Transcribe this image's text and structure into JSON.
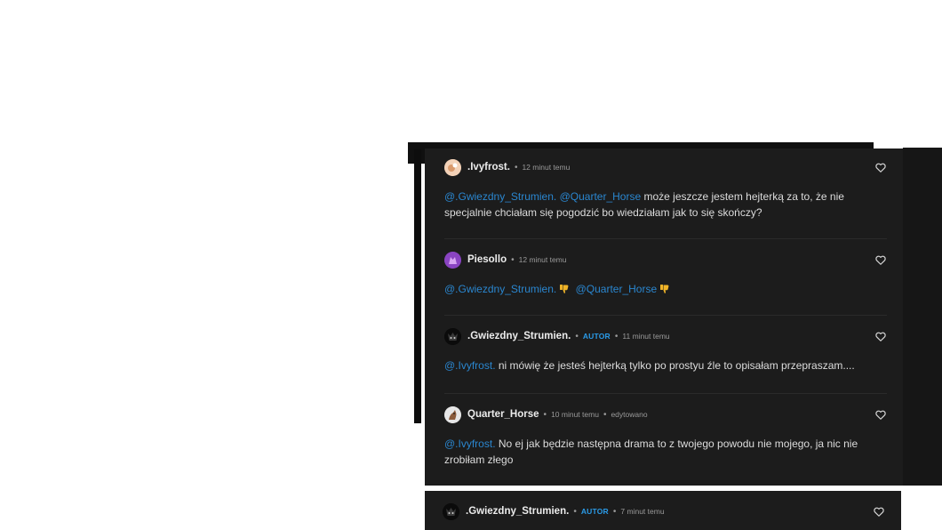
{
  "comments": [
    {
      "username": ".Ivyfrost.",
      "time": "12 minut temu",
      "mentions": [
        "@.Gwiezdny_Strumien.",
        "@Quarter_Horse"
      ],
      "text": "może jeszcze jestem hejterką za to, że nie specjalnie chciałam się pogodzić bo wiedziałam jak to się skończy?"
    },
    {
      "username": "Piesollo",
      "time": "12 minut temu",
      "mentions": [
        "@.Gwiezdny_Strumien.",
        "@Quarter_Horse"
      ],
      "reaction_icon": "thumbs-down-emoji"
    },
    {
      "username": ".Gwiezdny_Strumien.",
      "badge": "AUTOR",
      "time": "11 minut temu",
      "mentions": [
        "@.Ivyfrost."
      ],
      "text": "ni mówię że jesteś hejterką tylko po prostyu źle to opisałam przepraszam...."
    },
    {
      "username": "Quarter_Horse",
      "time": "10 minut temu",
      "edited": "edytowano",
      "mentions": [
        "@.Ivyfrost."
      ],
      "text": "No ej jak będzie następna drama to z twojego powodu nie mojego, ja nic nie zrobiłam złego"
    },
    {
      "username": ".Gwiezdny_Strumien.",
      "badge": "AUTOR",
      "time": "7 minut temu"
    }
  ],
  "colors": {
    "panel_bg": "#1c1c1c",
    "mention": "#2a86cf",
    "badge": "#2a9be8",
    "thumb_emoji": "#f0b428"
  },
  "icons": {
    "like": "heart-outline-icon",
    "separator": "dot"
  }
}
